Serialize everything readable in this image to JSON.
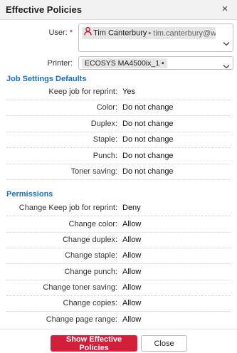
{
  "dialog": {
    "title": "Effective Policies",
    "close_glyph": "×"
  },
  "form": {
    "user_label": "User:",
    "required_marker": "*",
    "user_name": "Tim Canterbury",
    "user_email": "• tim.canterbury@werner",
    "printer_label": "Printer:",
    "printer_value": "ECOSYS MA4500ix_1 •"
  },
  "job_settings": {
    "title": "Job Settings Defaults",
    "rows": [
      {
        "label": "Keep job for reprint:",
        "value": "Yes"
      },
      {
        "label": "Color:",
        "value": "Do not change"
      },
      {
        "label": "Duplex:",
        "value": "Do not change"
      },
      {
        "label": "Staple:",
        "value": "Do not change"
      },
      {
        "label": "Punch:",
        "value": "Do not change"
      },
      {
        "label": "Toner saving:",
        "value": "Do not change"
      }
    ]
  },
  "permissions": {
    "title": "Permissions",
    "rows": [
      {
        "label": "Change Keep job for reprint:",
        "value": "Deny"
      },
      {
        "label": "Change color:",
        "value": "Allow"
      },
      {
        "label": "Change duplex:",
        "value": "Allow"
      },
      {
        "label": "Change staple:",
        "value": "Allow"
      },
      {
        "label": "Change punch:",
        "value": "Allow"
      },
      {
        "label": "Change toner saving:",
        "value": "Allow"
      },
      {
        "label": "Change copies:",
        "value": "Allow"
      },
      {
        "label": "Change page range:",
        "value": "Allow"
      }
    ]
  },
  "buttons": {
    "show_label": "Show Effective Policies",
    "close_label": "Close"
  },
  "colors": {
    "accent": "#1a6ec0",
    "primary_button": "#d41f3c",
    "required": "#d0021b",
    "user_icon": "#d0021b"
  },
  "icons": {
    "user": "person-icon",
    "dropdown": "chevron-down-icon",
    "close": "close-icon"
  }
}
